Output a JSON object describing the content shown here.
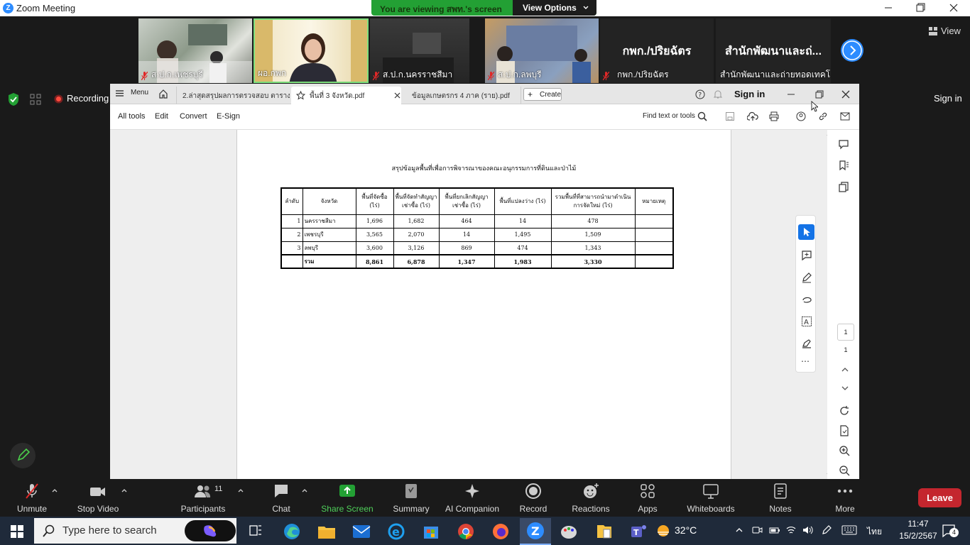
{
  "window": {
    "title": "Zoom Meeting"
  },
  "banner": {
    "text": "You are viewing สพท.'s screen",
    "view_options": "View Options"
  },
  "gallery": {
    "participants": [
      "ส.ป.ก.เพชรบุรี",
      "ผอ.กพก",
      "ส.ป.ก.นครราชสีมา",
      "ส.ป.ก.ลพบุรี",
      "กพก./ปริยฉัตร",
      "สำนักพัฒนาและถ่ายทอดเทคโ..."
    ],
    "big_names": [
      "กพก./ปริยฉัตร",
      "สำนักพัฒนาและถ่..."
    ],
    "view_label": "View"
  },
  "zoom_side": {
    "recording": "Recording",
    "sign_in": "Sign in"
  },
  "acrobat": {
    "menu": "Menu",
    "tabs": [
      "2.ล่าสุดสรุปผลการตรวจสอบ ตาราง 4 ภา...",
      "พื้นที่ 3 จังหวัด.pdf",
      "ข้อมูลเกษตรกร 4 ภาค (ราย).pdf"
    ],
    "create": "Create",
    "sign_in": "Sign in",
    "tools": [
      "All tools",
      "Edit",
      "Convert",
      "E-Sign"
    ],
    "find": "Find text or tools",
    "page_current": "1",
    "page_total": "1"
  },
  "document": {
    "title": "สรุปข้อมูลพื้นที่เพื่อการพิจารณาของคณะอนุกรรมการที่ดินและป่าไม้",
    "headers": [
      "ลำดับ",
      "จังหวัด",
      "พื้นที่จัดซื้อ (ไร่)",
      "พื้นที่จัดทำสัญญาเช่าซื้อ (ไร่)",
      "พื้นที่ยกเลิกสัญญาเช่าซื้อ (ไร่)",
      "พื้นที่แปลงว่าง (ไร่)",
      "รวมพื้นที่ที่สามารถนำมาดำเนินการจัดใหม่ (ไร่)",
      "หมายเหตุ"
    ],
    "rows": [
      [
        "1",
        "นครราชสีมา",
        "1,696",
        "1,682",
        "464",
        "14",
        "478",
        ""
      ],
      [
        "2",
        "เพชรบุรี",
        "3,565",
        "2,070",
        "14",
        "1,495",
        "1,509",
        ""
      ],
      [
        "3",
        "ลพบุรี",
        "3,600",
        "3,126",
        "869",
        "474",
        "1,343",
        ""
      ]
    ],
    "total": [
      "",
      "รวม",
      "8,861",
      "6,878",
      "1,347",
      "1,983",
      "3,330",
      ""
    ]
  },
  "toolbar": {
    "unmute": "Unmute",
    "stop_video": "Stop Video",
    "participants": "Participants",
    "participants_count": "11",
    "chat": "Chat",
    "share": "Share Screen",
    "summary": "Summary",
    "ai": "AI Companion",
    "record": "Record",
    "reactions": "Reactions",
    "apps": "Apps",
    "whiteboards": "Whiteboards",
    "notes": "Notes",
    "more": "More",
    "leave": "Leave"
  },
  "taskbar": {
    "search": "Type here to search",
    "temp": "32°C",
    "lang": "ไทย",
    "time": "11:47",
    "date": "15/2/2567",
    "notif": "4"
  },
  "colors": {
    "zoom_blue": "#2d8cff",
    "share_green": "#23a034",
    "leave_red": "#c4262e",
    "acro_blue": "#1473e6"
  }
}
